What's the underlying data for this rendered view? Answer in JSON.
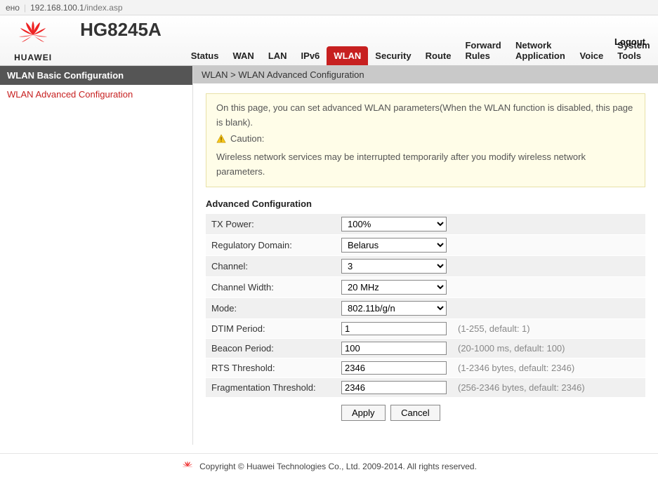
{
  "url": {
    "prefix": "ено",
    "host": "192.168.100.1",
    "path": "/index.asp"
  },
  "brand": {
    "name": "HUAWEI",
    "model": "HG8245A"
  },
  "logout": "Logout",
  "nav": {
    "items": [
      {
        "label": "Status"
      },
      {
        "label": "WAN"
      },
      {
        "label": "LAN"
      },
      {
        "label": "IPv6"
      },
      {
        "label": "WLAN",
        "active": true
      },
      {
        "label": "Security"
      },
      {
        "label": "Route"
      },
      {
        "label": "Forward Rules"
      },
      {
        "label": "Network Application"
      },
      {
        "label": "Voice"
      },
      {
        "label": "System Tools"
      }
    ]
  },
  "sidebar": {
    "items": [
      {
        "label": "WLAN Basic Configuration",
        "kind": "header"
      },
      {
        "label": "WLAN Advanced Configuration",
        "selected": true
      }
    ]
  },
  "breadcrumb": "WLAN > WLAN Advanced Configuration",
  "notice": {
    "line1": "On this page, you can set advanced WLAN parameters(When the WLAN function is disabled, this page is blank).",
    "caution_label": "Caution:",
    "line2": "Wireless network services may be interrupted temporarily after you modify wireless network parameters."
  },
  "section_title": "Advanced Configuration",
  "fields": {
    "tx_power": {
      "label": "TX Power:",
      "value": "100%"
    },
    "reg_domain": {
      "label": "Regulatory Domain:",
      "value": "Belarus"
    },
    "channel": {
      "label": "Channel:",
      "value": "3"
    },
    "channel_width": {
      "label": "Channel Width:",
      "value": "20 MHz"
    },
    "mode": {
      "label": "Mode:",
      "value": "802.11b/g/n"
    },
    "dtim": {
      "label": "DTIM Period:",
      "value": "1",
      "hint": "(1-255, default: 1)"
    },
    "beacon": {
      "label": "Beacon Period:",
      "value": "100",
      "hint": "(20-1000 ms, default: 100)"
    },
    "rts": {
      "label": "RTS Threshold:",
      "value": "2346",
      "hint": "(1-2346 bytes, default: 2346)"
    },
    "frag": {
      "label": "Fragmentation Threshold:",
      "value": "2346",
      "hint": "(256-2346 bytes, default: 2346)"
    }
  },
  "buttons": {
    "apply": "Apply",
    "cancel": "Cancel"
  },
  "footer": "Copyright © Huawei Technologies Co., Ltd. 2009-2014. All rights reserved.",
  "colors": {
    "accent_red": "#c72020",
    "notice_bg": "#fffde8"
  }
}
